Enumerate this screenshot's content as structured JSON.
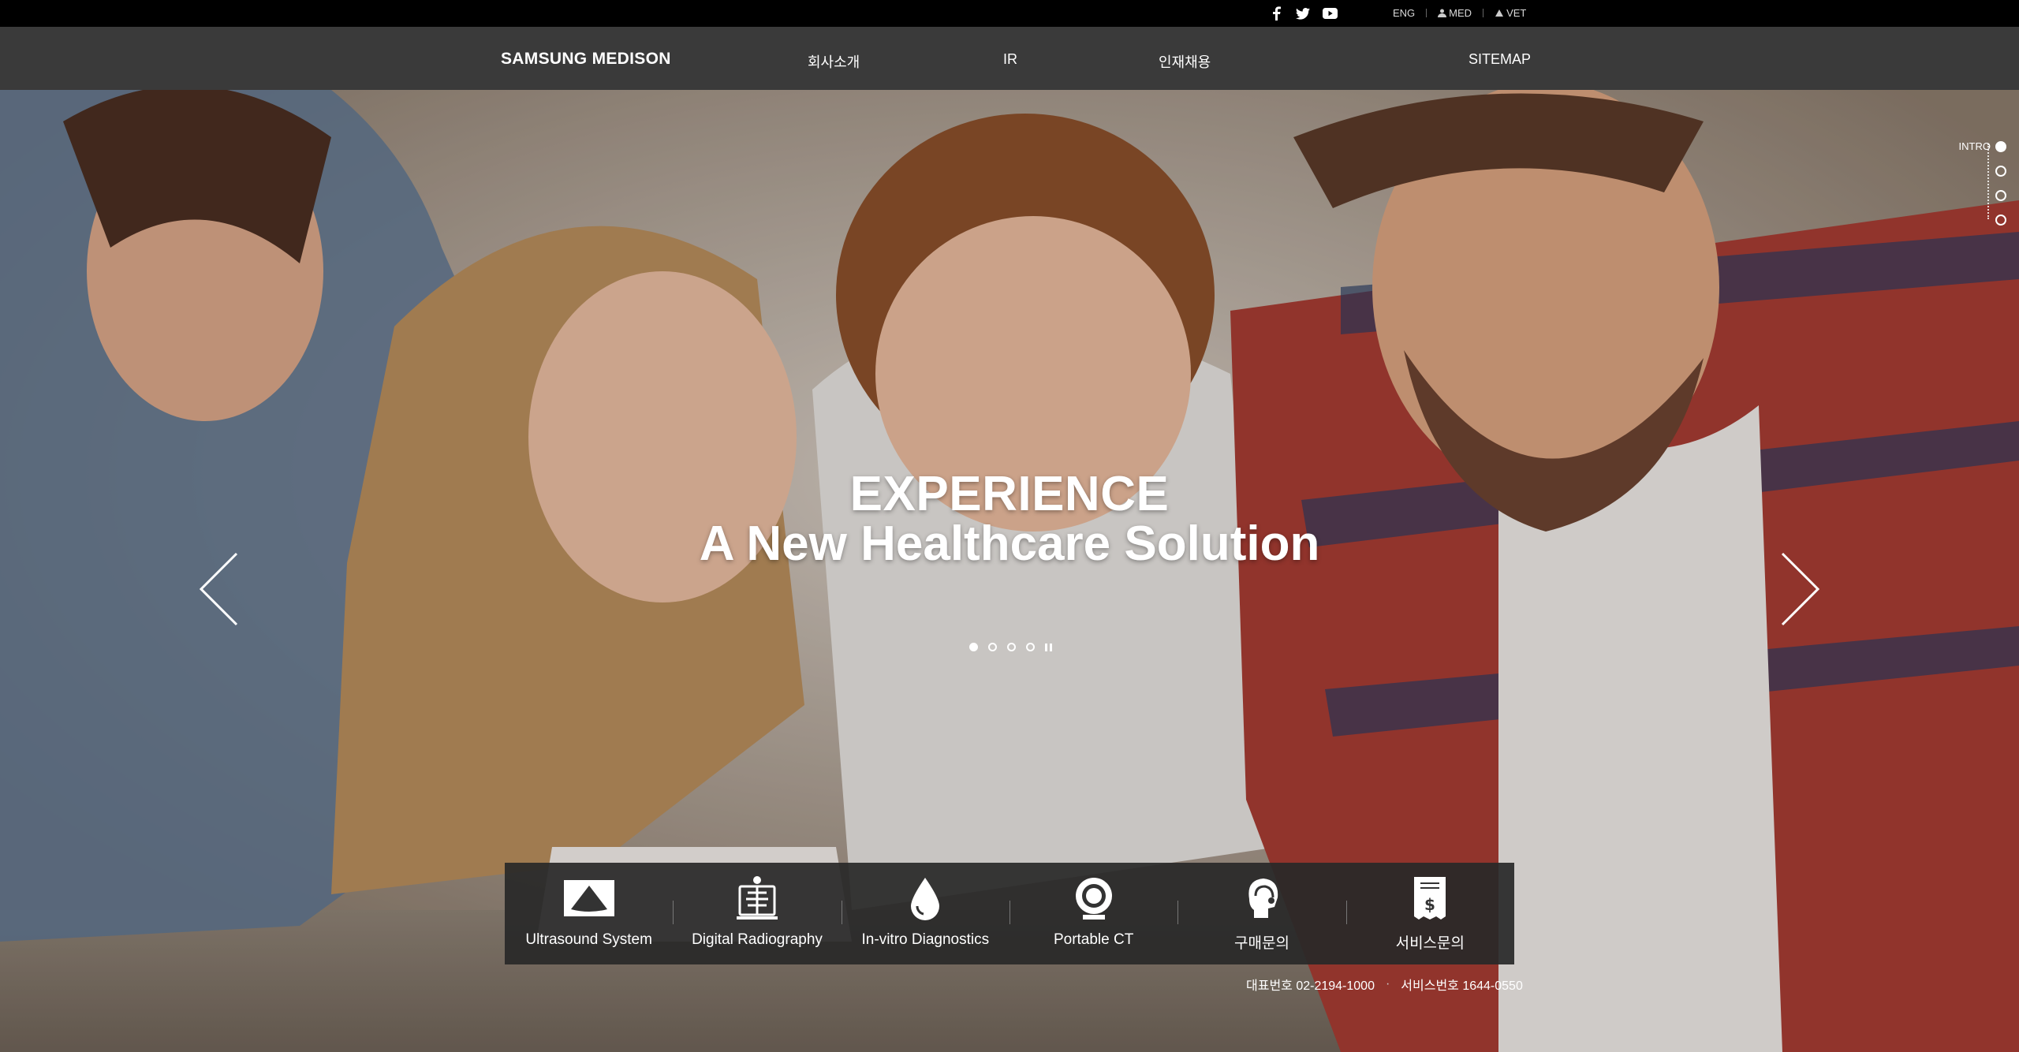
{
  "topbar": {
    "social": [
      {
        "icon": "facebook-icon"
      },
      {
        "icon": "twitter-icon"
      },
      {
        "icon": "youtube-icon"
      }
    ],
    "links": [
      {
        "label": "ENG"
      },
      {
        "label": "MED",
        "icon": "user-icon"
      },
      {
        "label": "VET",
        "icon": "paw-icon"
      }
    ]
  },
  "nav": {
    "brand": "SAMSUNG MEDISON",
    "items": [
      "회사소개",
      "IR",
      "인재채용",
      "SITEMAP"
    ]
  },
  "hero": {
    "headline_line1": "EXPERIENCE",
    "headline_line2": "A New Healthcare Solution",
    "slides_total": 4,
    "slide_active": 1
  },
  "sidenav": {
    "items": [
      {
        "label": "INTRO",
        "active": true
      },
      {
        "label": "",
        "active": false
      },
      {
        "label": "",
        "active": false
      },
      {
        "label": "",
        "active": false
      }
    ]
  },
  "quick_menu": [
    {
      "label": "Ultrasound System",
      "icon": "ultrasound-icon"
    },
    {
      "label": "Digital Radiography",
      "icon": "radiography-icon"
    },
    {
      "label": "In-vitro Diagnostics",
      "icon": "droplet-icon"
    },
    {
      "label": "Portable CT",
      "icon": "ct-scanner-icon"
    },
    {
      "label": "구매문의",
      "icon": "headset-icon"
    },
    {
      "label": "서비스문의",
      "icon": "receipt-icon"
    }
  ],
  "contact": {
    "main": "대표번호 02-2194-1000",
    "bullet": "·",
    "service": "서비스번호 1644-0550"
  },
  "colors": {
    "topbar": "#000000",
    "navbar": "#3a3a3a",
    "quick_menu_bg": "#282828"
  }
}
